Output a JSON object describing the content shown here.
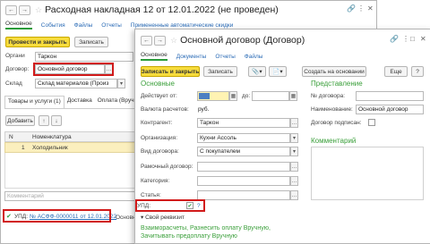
{
  "back_window": {
    "title": "Расходная накладная 12 от 12.01.2022 (не проведен)",
    "tabs": [
      "Основное",
      "События",
      "Файлы",
      "Отчеты",
      "Примененные автоматические скидки"
    ],
    "toolbar": {
      "post_close": "Провести и закрыть",
      "save": "Записать",
      "more": "Ещ"
    },
    "fields": {
      "org_label": "Органи",
      "org_value": "Таркон",
      "contract_label": "Договор:",
      "contract_value": "Основной договор",
      "warehouse_label": "Склад",
      "warehouse_value": "Склад материалов (Произ"
    },
    "items_tabs": [
      "Товары и услуги (1)",
      "Доставка",
      "Оплата (Вручную)"
    ],
    "add_button": "Добавить",
    "table": {
      "col_n": "N",
      "col_name": "Номенклатура",
      "rows": [
        {
          "n": "1",
          "name": "Холодильник"
        }
      ]
    },
    "comment_placeholder": "Комментарий",
    "upd_label": "УПД:",
    "upd_link": "№ АСФФ-0000011 от 12.01.2022",
    "footer_text": "Основна"
  },
  "front_window": {
    "title": "Основной договор (Договор)",
    "tabs": [
      "Основное",
      "Документы",
      "Отчеты",
      "Файлы"
    ],
    "toolbar": {
      "save_close": "Записать и закрыть",
      "save": "Записать",
      "create_based": "Создать на основании",
      "more": "Еще",
      "help": "?"
    },
    "main_section": "Основные",
    "fields": {
      "effective_label": "Действует от:",
      "effective_value": "",
      "to_label": "до:",
      "to_value": "",
      "currency_label": "Валюта расчетов:",
      "currency_value": "руб.",
      "counterparty_label": "Контрагент:",
      "counterparty_value": "Таркон",
      "org_label": "Организация:",
      "org_value": "Кухни Ассоль",
      "type_label": "Вид договора:",
      "type_value": "С покупателем",
      "frame_label": "Рамочный договор:",
      "frame_value": "",
      "category_label": "Категория:",
      "category_value": "",
      "article_label": "Статья:",
      "article_value": "",
      "upd_label": "УПД:",
      "upd_help": "?"
    },
    "own_requisite": "Свой реквизит",
    "settlement_link": "Взаиморасчеты, Разнесить оплату Вручную, Зачитывать предоплату Вручную",
    "presentation_section": "Представление",
    "contract_no_label": "№ договора:",
    "name_label": "Наименование:",
    "name_value": "Основной договор",
    "signed_label": "Договор подписан:",
    "comment_section": "Комментарий"
  },
  "colors": {
    "accent_yellow": "#f7dc3c",
    "highlight_red": "#d11a1a",
    "section_green": "#3a9f3a",
    "link_blue": "#2a6bb6"
  }
}
